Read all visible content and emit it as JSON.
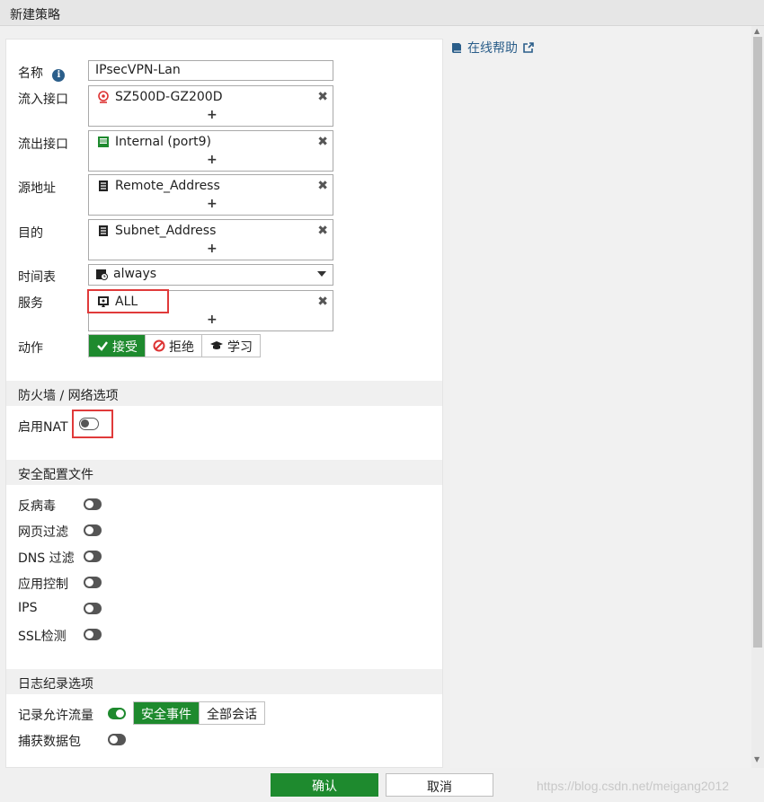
{
  "window": {
    "title": "新建策略"
  },
  "help": {
    "label": "在线帮助"
  },
  "form": {
    "name": {
      "label": "名称",
      "value": "IPsecVPN-Lan"
    },
    "incoming": {
      "label": "流入接口",
      "value": "SZ500D-GZ200D"
    },
    "outgoing": {
      "label": "流出接口",
      "value": "Internal (port9)"
    },
    "source": {
      "label": "源地址",
      "value": "Remote_Address"
    },
    "destination": {
      "label": "目的",
      "value": "Subnet_Address"
    },
    "schedule": {
      "label": "时间表",
      "value": "always"
    },
    "service": {
      "label": "服务",
      "value": "ALL"
    },
    "action": {
      "label": "动作",
      "options": [
        "接受",
        "拒绝",
        "学习"
      ]
    },
    "add_symbol": "+",
    "remove_symbol": "✖"
  },
  "firewall_section": {
    "title": "防火墙 / 网络选项",
    "nat_label": "启用NAT"
  },
  "security_section": {
    "title": "安全配置文件",
    "items": [
      "反病毒",
      "网页过滤",
      "DNS 过滤",
      "应用控制",
      "IPS",
      "SSL检测"
    ]
  },
  "logging_section": {
    "title": "日志纪录选项",
    "log_label": "记录允许流量",
    "log_options": [
      "安全事件",
      "全部会话"
    ],
    "capture_label": "捕获数据包"
  },
  "footer": {
    "ok": "确认",
    "cancel": "取消",
    "watermark": "https://blog.csdn.net/meigang2012"
  },
  "colors": {
    "accent": "#1e8a2e",
    "link": "#2b5e8a",
    "highlight": "#e03a3a"
  }
}
